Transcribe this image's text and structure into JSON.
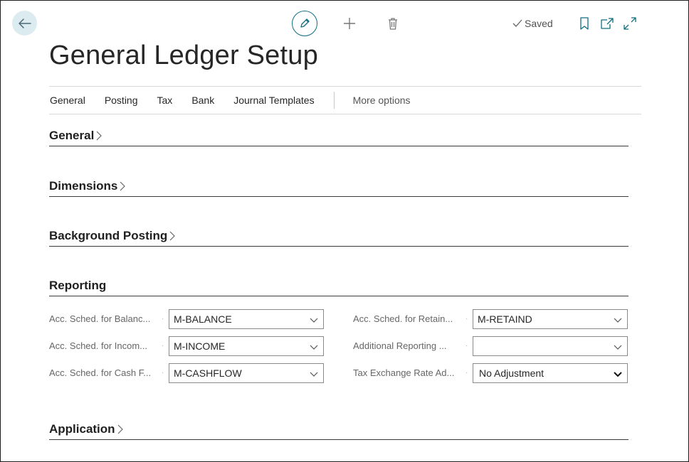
{
  "toolbar": {
    "saved_label": "Saved",
    "icons": {
      "back": "back-arrow-icon",
      "edit": "pencil-icon",
      "new": "plus-icon",
      "delete": "trash-icon",
      "saved": "checkmark-icon",
      "bookmark": "bookmark-icon",
      "open_new": "open-new-window-icon",
      "expand": "expand-icon"
    }
  },
  "page": {
    "title": "General Ledger Setup"
  },
  "menu": {
    "items": [
      "General",
      "Posting",
      "Tax",
      "Bank",
      "Journal Templates"
    ],
    "more": "More options"
  },
  "sections": {
    "general": "General",
    "dimensions": "Dimensions",
    "background_posting": "Background Posting",
    "reporting": "Reporting",
    "application": "Application"
  },
  "reporting": {
    "left": [
      {
        "label": "Acc. Sched. for Balanc...",
        "value": "M-BALANCE"
      },
      {
        "label": "Acc. Sched. for Incom...",
        "value": "M-INCOME"
      },
      {
        "label": "Acc. Sched. for Cash F...",
        "value": "M-CASHFLOW"
      }
    ],
    "right": [
      {
        "label": "Acc. Sched. for Retain...",
        "value": "M-RETAIND"
      },
      {
        "label": "Additional Reporting ...",
        "value": ""
      },
      {
        "label": "Tax Exchange Rate Ad...",
        "value": "No Adjustment"
      }
    ]
  },
  "colors": {
    "accent": "#0f6e80",
    "back_button_bg": "#dcebf0"
  }
}
